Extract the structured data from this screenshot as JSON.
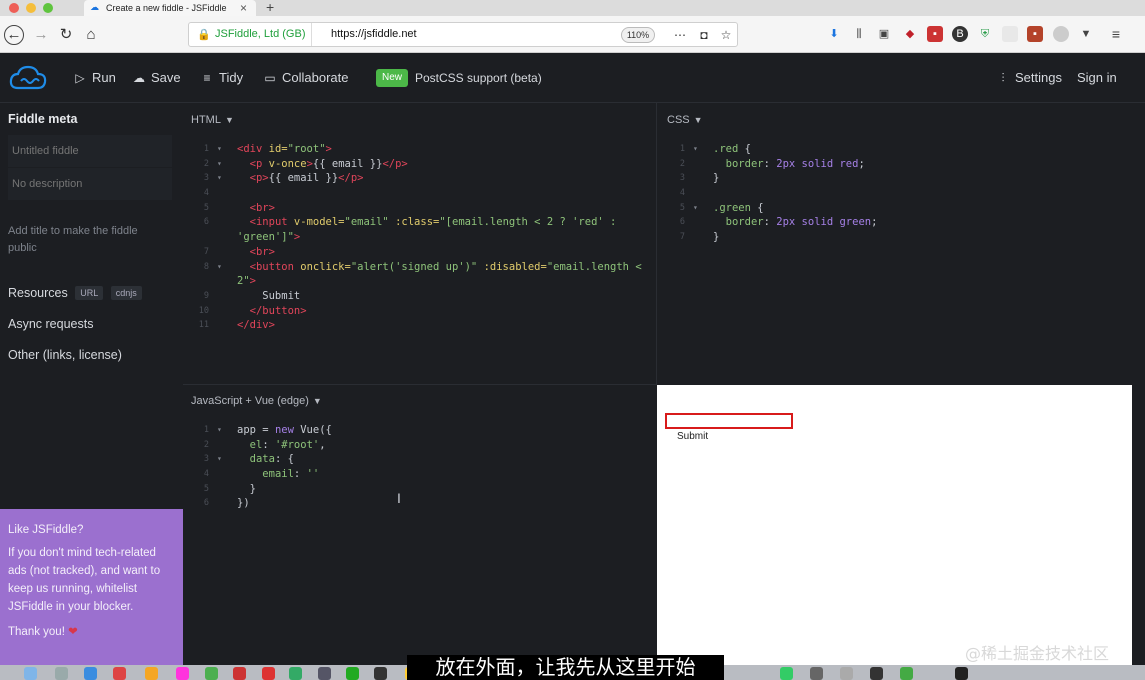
{
  "browser": {
    "tab_title": "Create a new fiddle - JSFiddle",
    "tab_close": "×",
    "new_tab": "+",
    "identity": "JSFiddle, Ltd (GB)",
    "url": "https://jsfiddle.net",
    "zoom": "110%"
  },
  "app": {
    "run": "Run",
    "save": "Save",
    "tidy": "Tidy",
    "collaborate": "Collaborate",
    "new_badge": "New",
    "postcss": "PostCSS support (beta)",
    "settings": "Settings",
    "sign_in": "Sign in"
  },
  "sidebar": {
    "title": "Fiddle meta",
    "title_placeholder": "Untitled fiddle",
    "desc_placeholder": "No description",
    "hint": "Add title to make the fiddle public",
    "resources": "Resources",
    "chip_url": "URL",
    "chip_cdnjs": "cdnjs",
    "async": "Async requests",
    "other": "Other (links, license)"
  },
  "ad": {
    "title": "Like JSFiddle?",
    "body": "If you don't mind tech-related ads (not tracked), and want to keep us running, whitelist JSFiddle in your blocker.",
    "thanks": "Thank you!",
    "heart": "❤"
  },
  "panes": {
    "html": "HTML",
    "css": "CSS",
    "js": "JavaScript + Vue (edge)"
  },
  "result": {
    "button": "Submit"
  },
  "overlay": {
    "subtitle": "放在外面，让我先从这里开始",
    "watermark": "@稀土掘金技术社区"
  }
}
